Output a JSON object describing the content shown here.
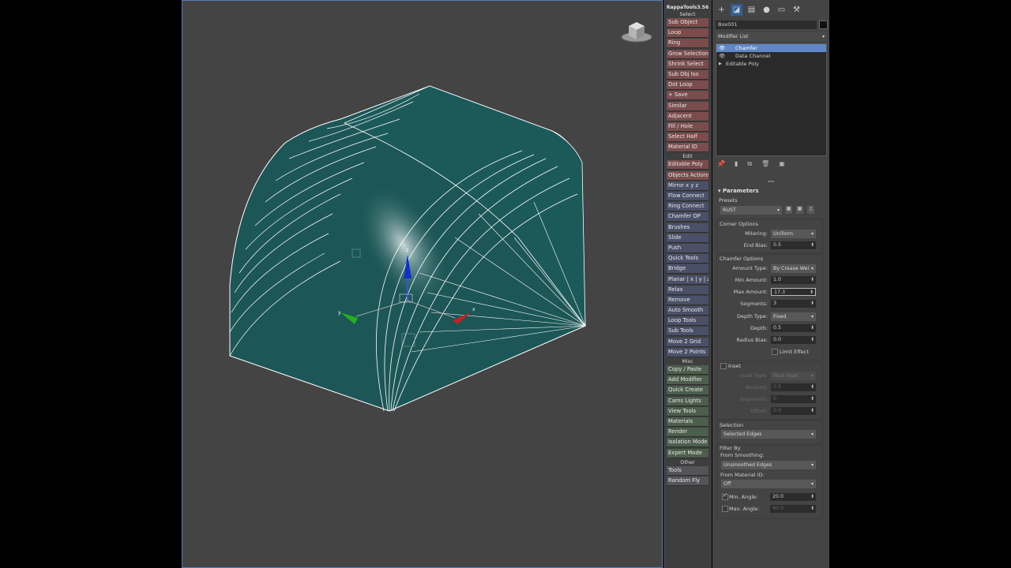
{
  "rappa": {
    "title": "RappaTools3.56",
    "items": [
      {
        "type": "section",
        "label": "Select"
      },
      {
        "type": "btn",
        "label": "Sub Object",
        "style": "red"
      },
      {
        "type": "btn",
        "label": "Loop",
        "style": "red"
      },
      {
        "type": "btn",
        "label": "Ring",
        "style": "red"
      },
      {
        "type": "btn",
        "label": "Grow Selection",
        "style": "red"
      },
      {
        "type": "btn",
        "label": "Shrink Select",
        "style": "red"
      },
      {
        "type": "btn",
        "label": "Sub Obj Iso",
        "style": "red"
      },
      {
        "type": "btn",
        "label": "Dot Loop",
        "style": "red"
      },
      {
        "type": "btn",
        "label": "+ Save",
        "style": "red"
      },
      {
        "type": "btn",
        "label": "Similar",
        "style": "red"
      },
      {
        "type": "btn",
        "label": "Adjacent",
        "style": "red"
      },
      {
        "type": "btn",
        "label": "Fill / Hole",
        "style": "red"
      },
      {
        "type": "btn",
        "label": "Select Half",
        "style": "red"
      },
      {
        "type": "btn",
        "label": "Material ID",
        "style": "red"
      },
      {
        "type": "section",
        "label": "Edit"
      },
      {
        "type": "btn",
        "label": "Editable Poly",
        "style": "red"
      },
      {
        "type": "btn",
        "label": "Objects Actions",
        "style": "red"
      },
      {
        "type": "btn",
        "label": "Mirror   x  y  z",
        "style": "blue"
      },
      {
        "type": "btn",
        "label": "Flow Connect",
        "style": "blue"
      },
      {
        "type": "btn",
        "label": "Ring Connect",
        "style": "blue"
      },
      {
        "type": "btn",
        "label": "Chamfer OP",
        "style": "blue"
      },
      {
        "type": "btn",
        "label": "Brushes",
        "style": "blue"
      },
      {
        "type": "btn",
        "label": "Slide",
        "style": "blue"
      },
      {
        "type": "btn",
        "label": "Push",
        "style": "blue"
      },
      {
        "type": "btn",
        "label": "Quick Tools",
        "style": "blue"
      },
      {
        "type": "btn",
        "label": "Bridge",
        "style": "blue"
      },
      {
        "type": "btn",
        "label": "Planar | x | y | z",
        "style": "blue"
      },
      {
        "type": "btn",
        "label": "Relax",
        "style": "blue"
      },
      {
        "type": "btn",
        "label": "Remove",
        "style": "blue"
      },
      {
        "type": "btn",
        "label": "Auto Smooth",
        "style": "blue"
      },
      {
        "type": "btn",
        "label": "Loop Tools",
        "style": "blue"
      },
      {
        "type": "btn",
        "label": "Sub Tools",
        "style": "blue"
      },
      {
        "type": "btn",
        "label": "Move 2 Grid",
        "style": "blue"
      },
      {
        "type": "btn",
        "label": "Move 2 Points",
        "style": "blue"
      },
      {
        "type": "section",
        "label": "Misc"
      },
      {
        "type": "btn",
        "label": "Copy / Paste",
        "style": "green"
      },
      {
        "type": "btn",
        "label": "Add Modifier",
        "style": "green"
      },
      {
        "type": "btn",
        "label": "Quick Create",
        "style": "green"
      },
      {
        "type": "btn",
        "label": "Cams Lights",
        "style": "green"
      },
      {
        "type": "btn",
        "label": "View Tools",
        "style": "green"
      },
      {
        "type": "btn",
        "label": "Materials",
        "style": "green"
      },
      {
        "type": "btn",
        "label": "Render",
        "style": "green"
      },
      {
        "type": "btn",
        "label": "Isolation Mode",
        "style": "green"
      },
      {
        "type": "btn",
        "label": "Expert Mode",
        "style": "green"
      },
      {
        "type": "section",
        "label": "Other"
      },
      {
        "type": "btn",
        "label": "Tools",
        "style": "plain"
      },
      {
        "type": "btn",
        "label": "Random Fly",
        "style": "plain"
      }
    ]
  },
  "panel": {
    "toolbar_icons": [
      "create-icon",
      "modify-icon",
      "hierarchy-icon",
      "motion-icon",
      "display-icon",
      "utilities-icon"
    ],
    "object_name": "Box001",
    "modifier_list": "Modifier List",
    "stack": [
      {
        "label": "Chamfer",
        "selected": true,
        "eye": true
      },
      {
        "label": "Data Channel",
        "selected": false,
        "eye": true
      },
      {
        "label": "Editable Poly",
        "selected": false,
        "eye": false
      }
    ],
    "rollout_title": "Parameters",
    "presets_label": "Presets",
    "preset_value": "RUST",
    "corner_options_label": "Corner Options",
    "mitering_label": "Mitering:",
    "mitering_value": "Uniform",
    "end_bias_label": "End Bias:",
    "end_bias_value": "0.5",
    "chamfer_options_label": "Chamfer Options",
    "amount_type_label": "Amount Type:",
    "amount_type_value": "By Crease Wei",
    "min_amount_label": "Min Amount:",
    "min_amount_value": "1.0",
    "max_amount_label": "Max Amount:",
    "max_amount_value": "17.3",
    "segments_label": "Segments:",
    "segments_value": "3",
    "depth_type_label": "Depth Type:",
    "depth_type_value": "Fixed",
    "depth_label": "Depth:",
    "depth_value": "0.5",
    "radius_bias_label": "Radius Bias:",
    "radius_bias_value": "0.0",
    "limit_effect_label": "Limit Effect",
    "inset_label": "Inset",
    "inset_type_label": "Inset Type:",
    "inset_type_value": "Face Inset",
    "inset_amount_label": "Amount:",
    "inset_amount_value": "0.5",
    "inset_segments_label": "Segments:",
    "inset_segments_value": "0",
    "offset_label": "Offset:",
    "offset_value": "0.0",
    "selection_label": "Selection",
    "selection_value": "Selected Edges",
    "filter_by_label": "Filter By",
    "from_smoothing_label": "From Smoothing:",
    "from_smoothing_value": "Unsmoothed Edges",
    "from_material_label": "From Material ID:",
    "from_material_value": "Off",
    "min_angle_label": "Min. Angle:",
    "min_angle_value": "20.0",
    "max_angle_label": "Max. Angle:",
    "max_angle_value": "90.0"
  },
  "gizmo": {
    "x_label": "x",
    "y_label": "y",
    "z_label": "z"
  },
  "colors": {
    "viewport_bg": "#444444",
    "mesh": "#1f5c5c",
    "selection": "#5f87c6"
  }
}
